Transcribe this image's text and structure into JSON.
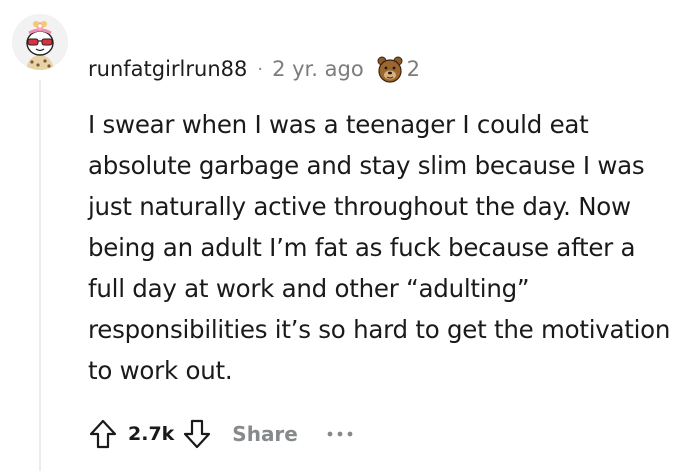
{
  "comment": {
    "username": "runfatgirlrun88",
    "separator": "·",
    "time": "2 yr. ago",
    "award_icon": "bear-award-icon",
    "award_count": "2",
    "body": "I swear when I was a teenager I could eat absolute garbage and stay slim because I was just naturally active throughout the day. Now being an adult I’m fat as fuck because after a full day at work and other “adulting” responsibilities it’s so hard to get the motivation to work out.",
    "score": "2.7k",
    "share_label": "Share",
    "more_icon": "more-options-icon",
    "upvote_icon": "upvote-arrow-icon",
    "downvote_icon": "downvote-arrow-icon"
  },
  "colors": {
    "text": "#1a1a1b",
    "meta": "#7c7c7c",
    "action": "#878a8c",
    "thread_line": "#ececec"
  }
}
